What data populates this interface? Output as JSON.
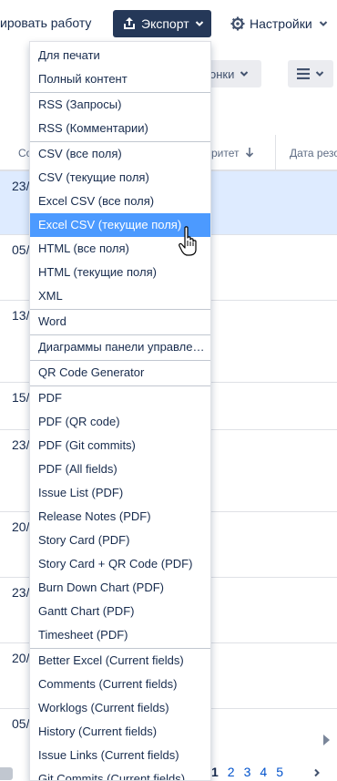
{
  "toolbar": {
    "link_text": "ировать работу",
    "export_label": "Экспорт",
    "settings_label": "Настройки",
    "columns_label": "онки",
    "export_icon": "export-icon",
    "settings_icon": "gear-icon",
    "view_icon": "list-icon"
  },
  "table": {
    "headers": [
      "Со",
      "ритет",
      "Дата резо"
    ],
    "sort_icon": "arrow-down-icon",
    "rows": [
      {
        "date": "23/",
        "selected": true
      },
      {
        "date": "05/"
      },
      {
        "date": "13/"
      },
      {
        "date": "15/"
      },
      {
        "date": "23/"
      },
      {
        "date": "20/"
      },
      {
        "date": "23/"
      },
      {
        "date": "20/"
      },
      {
        "date": "05/"
      }
    ]
  },
  "pagination": {
    "pages": [
      "1",
      "2",
      "3",
      "4",
      "5"
    ],
    "current": "1"
  },
  "menu": {
    "highlight_color": "#4c9aff",
    "groups": [
      [
        "Для печати",
        "Полный контент"
      ],
      [
        "RSS (Запросы)",
        "RSS (Комментарии)"
      ],
      [
        "CSV (все поля)",
        "CSV (текущие поля)",
        "Excel CSV (все поля)",
        "Excel CSV (текущие поля)",
        "HTML (все поля)",
        "HTML (текущие поля)",
        "XML"
      ],
      [
        "Word"
      ],
      [
        "Диаграммы панели управления"
      ],
      [
        "QR Code Generator"
      ],
      [
        "PDF",
        "PDF (QR code)",
        "PDF (Git commits)",
        "PDF (All fields)",
        "Issue List (PDF)",
        "Release Notes (PDF)",
        "Story Card (PDF)",
        "Story Card + QR Code (PDF)",
        "Burn Down Chart (PDF)",
        "Gantt Chart (PDF)",
        "Timesheet (PDF)"
      ],
      [
        "Better Excel (Current fields)",
        "Comments (Current fields)",
        "Worklogs (Current fields)",
        "History (Current fields)",
        "Issue Links (Current fields)",
        "Git Commits (Current fields)"
      ]
    ],
    "highlighted": "Excel CSV (текущие поля)"
  },
  "colors": {
    "export_button_bg": "#253858",
    "selected_row_bg": "#deebff",
    "link": "#0052cc"
  }
}
